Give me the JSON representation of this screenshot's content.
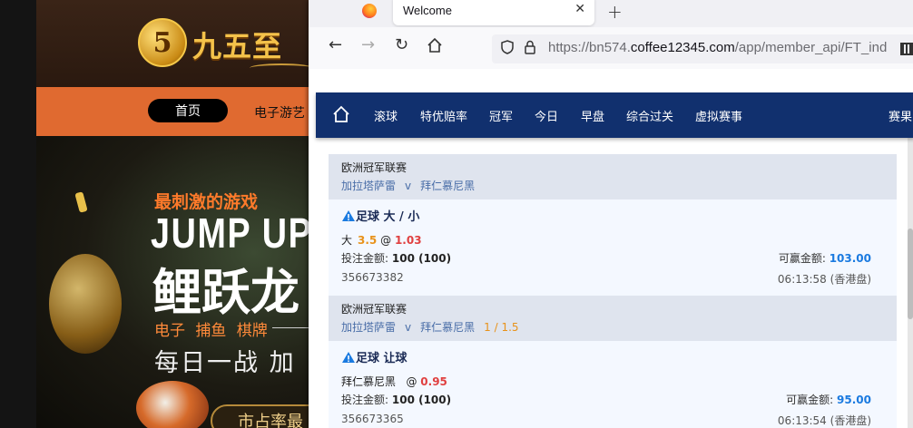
{
  "site": {
    "logo_digit": "5",
    "logo_text": "九五至",
    "nav_home": "首页",
    "nav_game": "电子游艺",
    "hero_line1": "最刺激的游戏",
    "hero_line2": "JUMP UP",
    "hero_line3": "鲤跃龙",
    "hero_line4": "电子 捕鱼 棋牌",
    "hero_line5": "每日一战 加",
    "hero_pill": "市占率最"
  },
  "browser": {
    "tab_title": "Welcome",
    "url_prefix": "https://bn574.",
    "url_domain": "coffee12345.com",
    "url_path": "/app/member_api/FT_ind"
  },
  "appnav": {
    "items": [
      "滚球",
      "特优赔率",
      "冠军",
      "今日",
      "早盘",
      "综合过关",
      "虚拟赛事",
      "赛果"
    ]
  },
  "bets": [
    {
      "league": "欧洲冠军联赛",
      "home": "加拉塔萨雷",
      "vs": "v",
      "away": "拜仁慕尼黑",
      "handicap": "",
      "type": "足球 大 / 小",
      "selection": "大",
      "line": "3.5",
      "at": "@",
      "odds": "1.03",
      "stake_label": "投注金额:",
      "stake": "100 (100)",
      "win_label": "可赢金额:",
      "win": "103.00",
      "ticket": "356673382",
      "time": "06:13:58 (香港盘)"
    },
    {
      "league": "欧洲冠军联赛",
      "home": "加拉塔萨雷",
      "vs": "v",
      "away": "拜仁慕尼黑",
      "handicap": "1 / 1.5",
      "type": "足球 让球",
      "selection": "拜仁慕尼黑",
      "line": "",
      "at": "@",
      "odds": "0.95",
      "stake_label": "投注金额:",
      "stake": "100 (100)",
      "win_label": "可赢金额:",
      "win": "95.00",
      "ticket": "356673365",
      "time": "06:13:54 (香港盘)"
    }
  ]
}
